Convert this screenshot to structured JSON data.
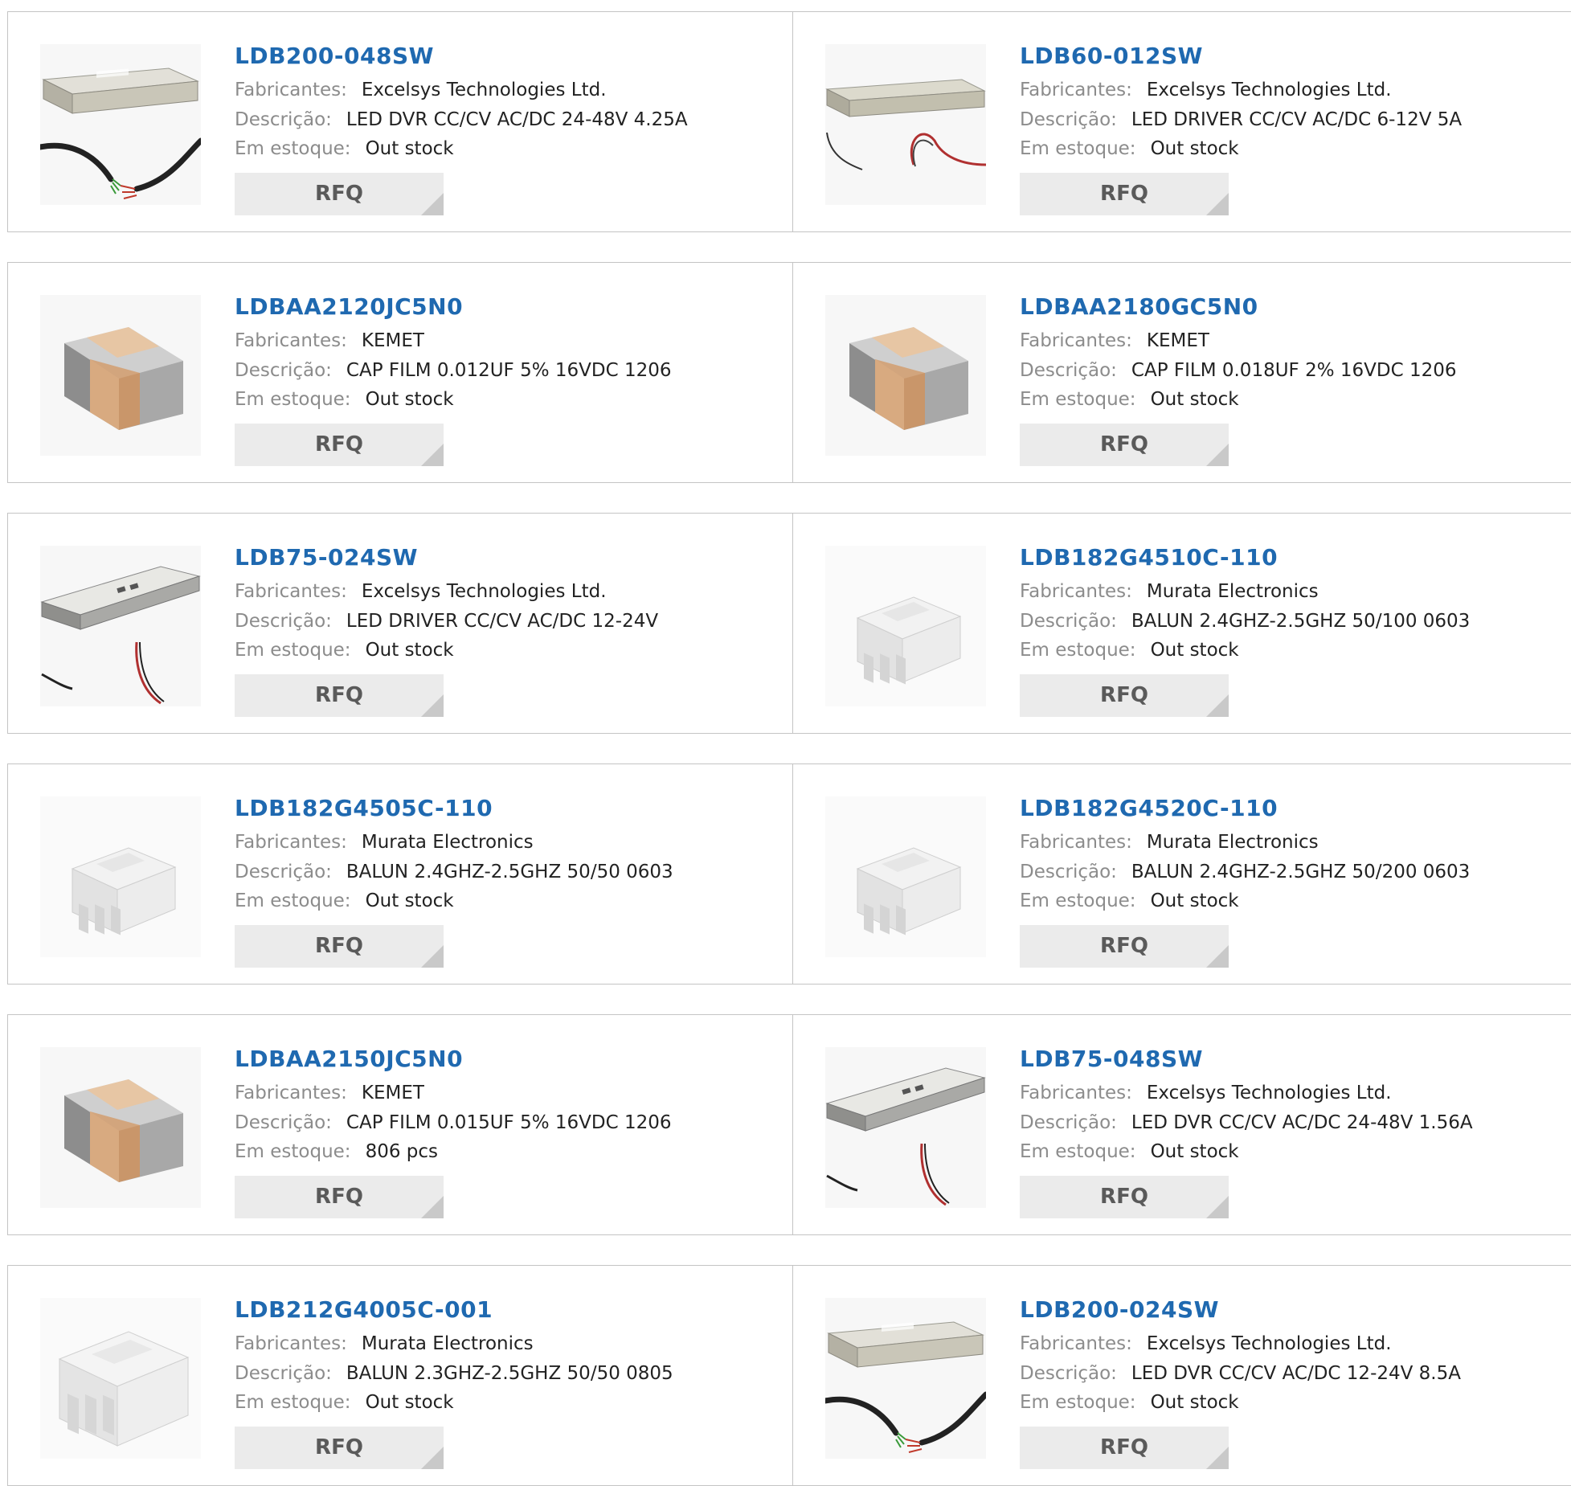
{
  "labels": {
    "manufacturer": "Fabricantes:",
    "description": "Descrição:",
    "stock": "Em estoque:",
    "rfq": "RFQ"
  },
  "products": [
    {
      "pn": "LDB200-048SW",
      "manufacturer": "Excelsys Technologies Ltd.",
      "description": "LED DVR CC/CV AC/DC 24-48V 4.25A",
      "stock": "Out stock",
      "image_icon": "led-driver-icon"
    },
    {
      "pn": "LDB60-012SW",
      "manufacturer": "Excelsys Technologies Ltd.",
      "description": "LED DRIVER CC/CV AC/DC 6-12V 5A",
      "stock": "Out stock",
      "image_icon": "led-driver-icon"
    },
    {
      "pn": "LDBAA2120JC5N0",
      "manufacturer": "KEMET",
      "description": "CAP FILM 0.012UF 5% 16VDC 1206",
      "stock": "Out stock",
      "image_icon": "smd-capacitor-icon"
    },
    {
      "pn": "LDBAA2180GC5N0",
      "manufacturer": "KEMET",
      "description": "CAP FILM 0.018UF 2% 16VDC 1206",
      "stock": "Out stock",
      "image_icon": "smd-capacitor-icon"
    },
    {
      "pn": "LDB75-024SW",
      "manufacturer": "Excelsys Technologies Ltd.",
      "description": "LED DRIVER CC/CV AC/DC 12-24V",
      "stock": "Out stock",
      "image_icon": "led-driver-icon"
    },
    {
      "pn": "LDB182G4510C-110",
      "manufacturer": "Murata Electronics",
      "description": "BALUN 2.4GHZ-2.5GHZ 50/100 0603",
      "stock": "Out stock",
      "image_icon": "balun-chip-icon"
    },
    {
      "pn": "LDB182G4505C-110",
      "manufacturer": "Murata Electronics",
      "description": "BALUN 2.4GHZ-2.5GHZ 50/50 0603",
      "stock": "Out stock",
      "image_icon": "balun-chip-icon"
    },
    {
      "pn": "LDB182G4520C-110",
      "manufacturer": "Murata Electronics",
      "description": "BALUN 2.4GHZ-2.5GHZ 50/200 0603",
      "stock": "Out stock",
      "image_icon": "balun-chip-icon"
    },
    {
      "pn": "LDBAA2150JC5N0",
      "manufacturer": "KEMET",
      "description": "CAP FILM 0.015UF 5% 16VDC 1206",
      "stock": "806 pcs",
      "image_icon": "smd-capacitor-icon"
    },
    {
      "pn": "LDB75-048SW",
      "manufacturer": "Excelsys Technologies Ltd.",
      "description": "LED DVR CC/CV AC/DC 24-48V 1.56A",
      "stock": "Out stock",
      "image_icon": "led-driver-icon"
    },
    {
      "pn": "LDB212G4005C-001",
      "manufacturer": "Murata Electronics",
      "description": "BALUN 2.3GHZ-2.5GHZ 50/50 0805",
      "stock": "Out stock",
      "image_icon": "balun-chip-icon"
    },
    {
      "pn": "LDB200-024SW",
      "manufacturer": "Excelsys Technologies Ltd.",
      "description": "LED DVR CC/CV AC/DC 12-24V 8.5A",
      "stock": "Out stock",
      "image_icon": "led-driver-icon"
    }
  ]
}
